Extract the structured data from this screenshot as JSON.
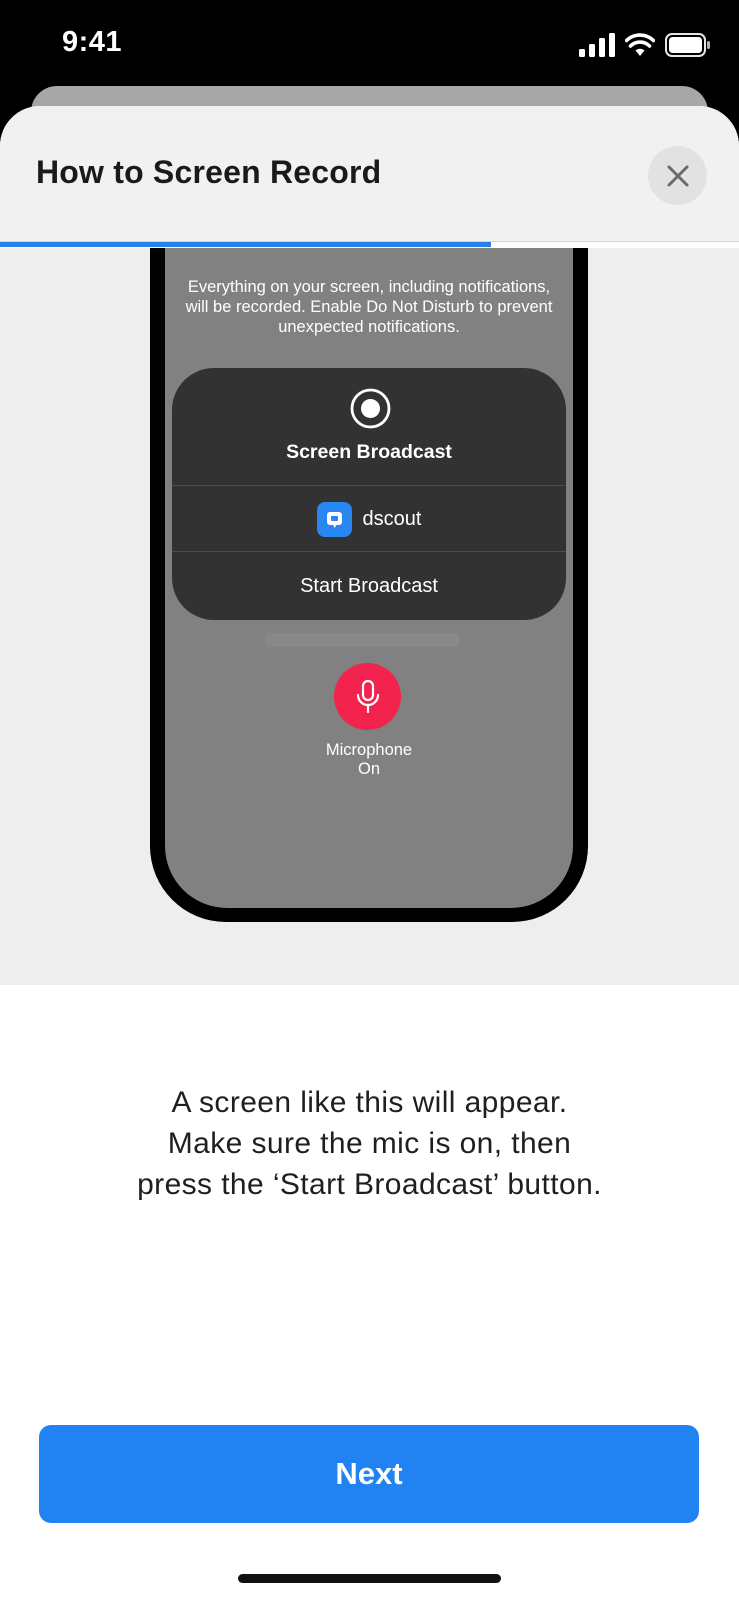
{
  "status_bar": {
    "time": "9:41",
    "icons": [
      "signal-icon",
      "wifi-icon",
      "battery-icon"
    ]
  },
  "sheet": {
    "title": "How to Screen Record",
    "close_icon": "close-icon",
    "progress_percent": 66.5
  },
  "illustration": {
    "notice": "Everything on your screen, including notifications, will be recorded. Enable Do Not Disturb to prevent unexpected notifications.",
    "broadcast_title": "Screen Broadcast",
    "app_name": "dscout",
    "start_label": "Start Broadcast",
    "mic_label_line1": "Microphone",
    "mic_label_line2": "On"
  },
  "instructions": {
    "line1": "A screen like this will appear.",
    "line2": "Make sure the mic is on, then",
    "line3": "press the ‘Start Broadcast’ button."
  },
  "footer": {
    "next_label": "Next"
  },
  "colors": {
    "accent": "#2183f2",
    "progress": "#2a7fe6",
    "mic": "#f2244e",
    "app_icon": "#2a86f0"
  }
}
